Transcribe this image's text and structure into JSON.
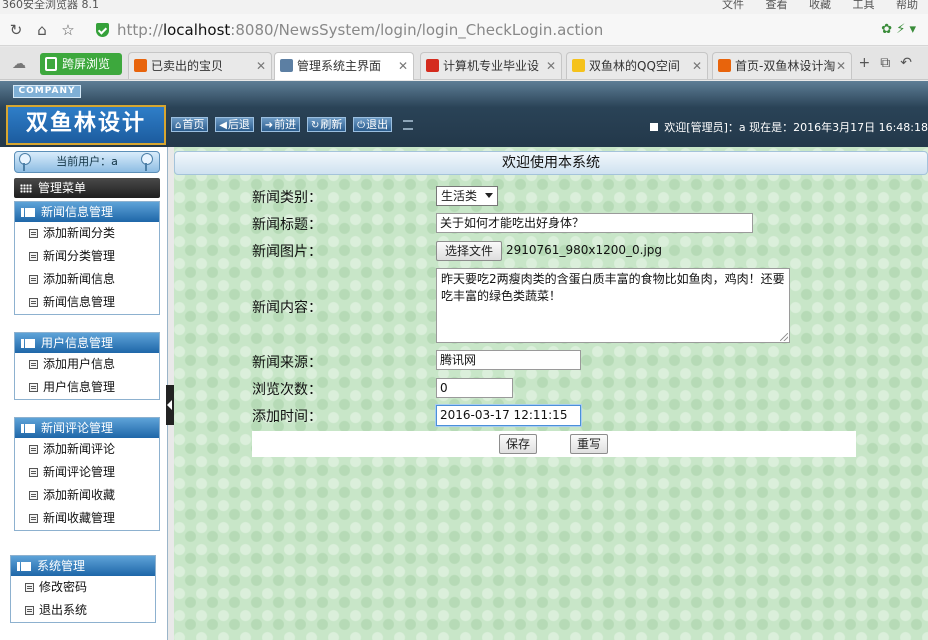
{
  "browser": {
    "app_title": "360安全浏览器 8.1",
    "menus": [
      "文件",
      "查看",
      "收藏",
      "工具",
      "帮助"
    ],
    "url_scheme": "http://",
    "url_host": "localhost",
    "url_rest": ":8080/NewsSystem/login/login_CheckLogin.action",
    "special_tab_label": "跨屏浏览",
    "tabs": [
      {
        "label": "已卖出的宝贝",
        "icon_color": "#e8640c",
        "active": false
      },
      {
        "label": "管理系统主界面",
        "icon_color": "#5c7fa3",
        "active": true
      },
      {
        "label": "计算机专业毕业设",
        "icon_color": "#d42b1e",
        "active": false
      },
      {
        "label": "双鱼林的QQ空间",
        "icon_color": "#f5c21b",
        "active": false
      },
      {
        "label": "首页-双鱼林设计淘",
        "icon_color": "#e8640c",
        "active": false
      }
    ]
  },
  "header": {
    "company": "COMPANY",
    "logo": "双鱼林设计",
    "buttons": [
      {
        "glyph": "⌂",
        "label": "首页"
      },
      {
        "glyph": "◀",
        "label": "后退"
      },
      {
        "glyph": "➜",
        "label": "前进"
      },
      {
        "glyph": "↻",
        "label": "刷新"
      },
      {
        "glyph": "⏻",
        "label": "退出"
      }
    ],
    "welcome": "欢迎[管理员]：a   现在是：2016年3月17日  16:48:18"
  },
  "sidebar": {
    "current_user": "当前用户：a",
    "menu_title": "管理菜单",
    "groups": [
      {
        "title": "新闻信息管理",
        "items": [
          "添加新闻分类",
          "新闻分类管理",
          "添加新闻信息",
          "新闻信息管理"
        ]
      },
      {
        "title": "用户信息管理",
        "items": [
          "添加用户信息",
          "用户信息管理"
        ]
      },
      {
        "title": "新闻评论管理",
        "items": [
          "添加新闻评论",
          "新闻评论管理",
          "添加新闻收藏",
          "新闻收藏管理"
        ]
      },
      {
        "title": "系统管理",
        "items": [
          "修改密码",
          "退出系统"
        ]
      }
    ]
  },
  "main": {
    "title": "欢迎使用本系统",
    "labels": {
      "category": "新闻类别：",
      "title": "新闻标题：",
      "image": "新闻图片：",
      "content": "新闻内容：",
      "source": "新闻来源：",
      "views": "浏览次数：",
      "time": "添加时间："
    },
    "category_value": "生活类",
    "title_value": "关于如何才能吃出好身体？",
    "file_button": "选择文件",
    "file_name": "2910761_980x1200_0.jpg",
    "content_value": "昨天要吃2两瘦肉类的含蛋白质丰富的食物比如鱼肉，鸡肉！还要吃丰富的绿色类蔬菜！",
    "source_value": "腾讯网",
    "views_value": "0",
    "time_value": "2016-03-17 12:11:15",
    "save_button": "保存",
    "reset_button": "重写"
  }
}
